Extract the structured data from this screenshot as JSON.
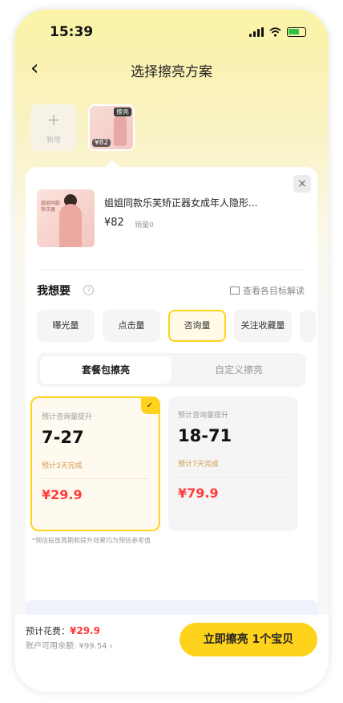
{
  "status": {
    "time": "15:39"
  },
  "nav": {
    "back_glyph": "‹",
    "title": "选择擦亮方案"
  },
  "thumbnails": {
    "add_plus": "+",
    "add_label": "新增",
    "product_tag": "擦亮",
    "product_price": "¥82"
  },
  "product": {
    "title": "姐姐同款乐芙矫正器女成年人隐形...",
    "price": "¥82",
    "sales": "销量0",
    "image_caption": "姐姐同款矫正器",
    "close_glyph": "×"
  },
  "goal_section": {
    "title": "我想要",
    "help_glyph": "?",
    "link": "查看各目标解读",
    "options": [
      "曝光量",
      "点击量",
      "咨询量",
      "关注收藏量"
    ],
    "selected": "咨询量"
  },
  "tabs": {
    "package": "套餐包擦亮",
    "custom": "自定义擦亮"
  },
  "plans": [
    {
      "label": "预计咨询量提升",
      "range": "7-27",
      "days": "预计3天完成",
      "price": "¥29.9",
      "check": "✓"
    },
    {
      "label": "预计咨询量提升",
      "range": "18-71",
      "days": "预计7天完成",
      "price": "¥79.9"
    }
  ],
  "note": "*预估投放周期和提升效果均为预估参考值",
  "footer": {
    "est_label": "预计花费：",
    "est_value": "¥29.9",
    "balance": "账户可用余额: ¥99.54 ›",
    "cta": "立即擦亮 1个宝贝"
  },
  "colors": {
    "accent": "#ffd21c",
    "price_red": "#ff3b3b",
    "battery_green": "#2ec246"
  }
}
